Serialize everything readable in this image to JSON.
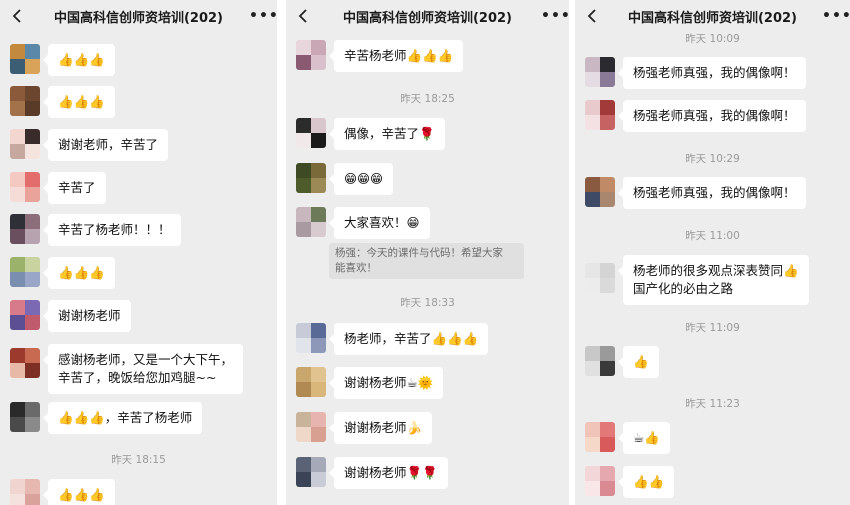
{
  "panels": [
    {
      "title": "中国高科信创师资培训(202)",
      "messages": [
        {
          "type": "msg",
          "text": "👍👍👍"
        },
        {
          "type": "msg",
          "text": "👍👍👍"
        },
        {
          "type": "msg",
          "text": "谢谢老师，辛苦了"
        },
        {
          "type": "msg",
          "text": "辛苦了"
        },
        {
          "type": "msg",
          "text": "辛苦了杨老师！！！"
        },
        {
          "type": "msg",
          "text": "👍👍👍"
        },
        {
          "type": "msg",
          "text": "谢谢杨老师"
        },
        {
          "type": "msg",
          "text": "感谢杨老师，又是一个大下午，\n辛苦了，晚饭给您加鸡腿~~"
        },
        {
          "type": "msg",
          "text": "👍👍👍，辛苦了杨老师"
        },
        {
          "type": "time",
          "text": "昨天 18:15"
        },
        {
          "type": "msg",
          "text": "👍👍👍"
        }
      ]
    },
    {
      "title": "中国高科信创师资培训(202)",
      "messages": [
        {
          "type": "msg",
          "text": "辛苦杨老师👍👍👍"
        },
        {
          "type": "time",
          "text": "昨天 18:25"
        },
        {
          "type": "msg",
          "text": "偶像，辛苦了🌹"
        },
        {
          "type": "msg",
          "text": "😁😁😁"
        },
        {
          "type": "msg",
          "text": "大家喜欢！😁"
        },
        {
          "type": "quote",
          "text": "杨强：今天的课件与代码！希望大家\n能喜欢！"
        },
        {
          "type": "time",
          "text": "昨天 18:33"
        },
        {
          "type": "msg",
          "text": "杨老师，辛苦了👍👍👍"
        },
        {
          "type": "msg",
          "text": "谢谢杨老师☕🌞"
        },
        {
          "type": "msg",
          "text": "谢谢杨老师🍌"
        },
        {
          "type": "msg",
          "text": "谢谢杨老师🌹🌹"
        }
      ]
    },
    {
      "title": "中国高科信创师资培训(202)",
      "messages": [
        {
          "type": "time",
          "text": "昨天 10:09"
        },
        {
          "type": "msg",
          "text": "杨强老师真强，我的偶像啊！"
        },
        {
          "type": "msg",
          "text": "杨强老师真强，我的偶像啊！"
        },
        {
          "type": "time",
          "text": "昨天 10:29"
        },
        {
          "type": "msg",
          "text": "杨强老师真强，我的偶像啊！"
        },
        {
          "type": "time",
          "text": "昨天 11:00"
        },
        {
          "type": "msg",
          "text": "杨老师的很多观点深表赞同👍\n国产化的必由之路"
        },
        {
          "type": "time",
          "text": "昨天 11:09"
        },
        {
          "type": "msg",
          "text": "👍"
        },
        {
          "type": "time",
          "text": "昨天 11:23"
        },
        {
          "type": "msg",
          "text": "☕👍"
        },
        {
          "type": "msg",
          "text": "👍👍"
        }
      ]
    }
  ]
}
